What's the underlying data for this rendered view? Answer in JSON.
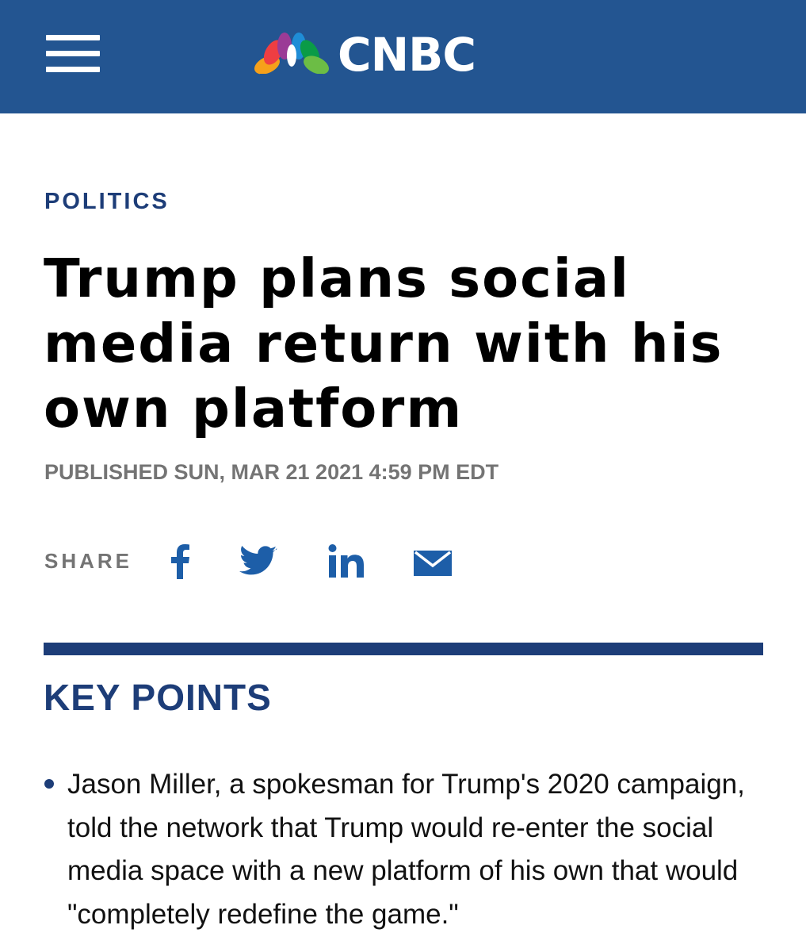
{
  "header": {
    "menu_icon": "hamburger-menu-icon",
    "logo_icon": "nbc-peacock-icon",
    "logo_text": "CNBC",
    "background_color": "#235591"
  },
  "article": {
    "section": "POLITICS",
    "headline": "Trump plans social media return with his own platform",
    "published": "PUBLISHED SUN, MAR 21 2021 4:59 PM EDT",
    "share": {
      "label": "SHARE",
      "icons": [
        "facebook-icon",
        "twitter-icon",
        "linkedin-icon",
        "email-icon"
      ]
    },
    "key_points": {
      "title": "KEY POINTS",
      "items": [
        "Jason Miller, a spokesman for Trump's 2020 campaign, told the network that Trump would re-enter the social media space with a new platform of his own that would \"completely redefine the game.\""
      ]
    }
  },
  "colors": {
    "accent": "#1d3d78",
    "meta_gray": "#747474"
  }
}
